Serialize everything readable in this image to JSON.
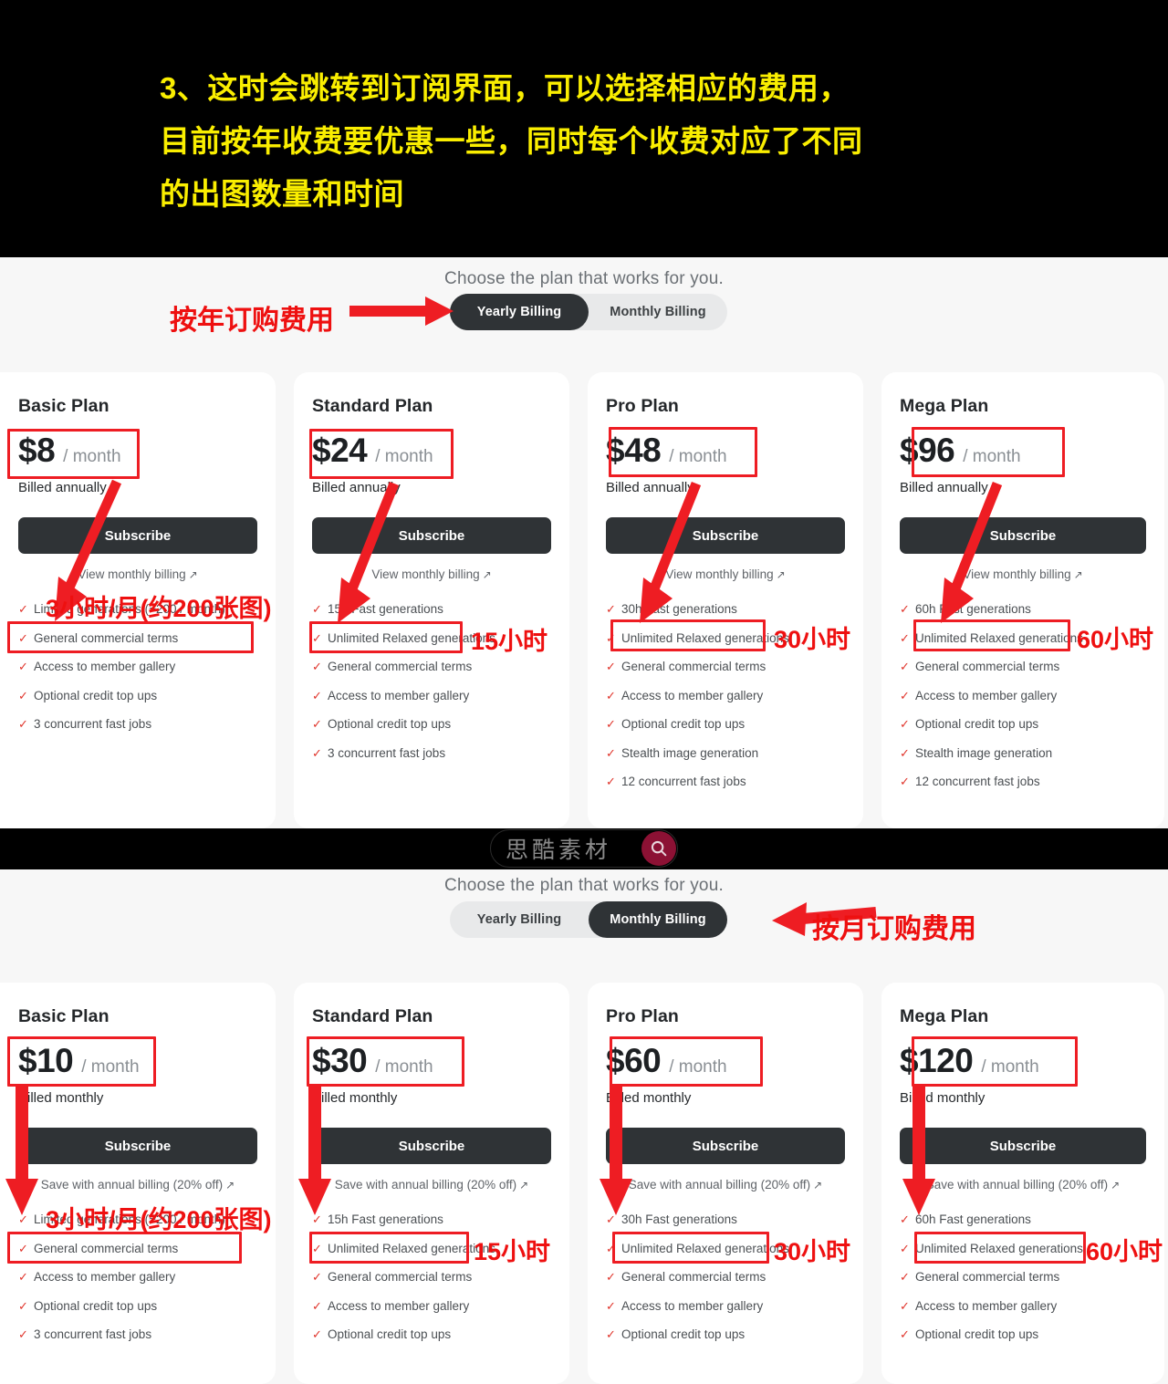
{
  "caption": {
    "text": "3、这时会跳转到订阅界面，可以选择相应的费用，\n目前按年收费要优惠一些，同时每个收费对应了不同\n的出图数量和时间",
    "color": "#FAEE00"
  },
  "watermark": {
    "text": "思酷素材",
    "icon": "search-icon",
    "circle_color": "#8c1134"
  },
  "annotations": {
    "yearly_arrow_label": "按年订购费用",
    "monthly_arrow_label": "按月订购费用",
    "basic_hours": "3小时/月(约200张图)",
    "standard_hours": "15小时",
    "pro_hours": "30小时",
    "mega_hours": "60小时",
    "highlight_color": "#ee1d23"
  },
  "sections": [
    {
      "id": "yearly",
      "heading": "Choose the plan that works for you.",
      "toggle": {
        "options": [
          {
            "label": "Yearly Billing",
            "active": true
          },
          {
            "label": "Monthly Billing",
            "active": false
          }
        ]
      },
      "cards": [
        {
          "name": "Basic Plan",
          "price": "$8",
          "unit": "/ month",
          "billed": "Billed annually",
          "subscribe_label": "Subscribe",
          "alt_link": "View monthly billing",
          "alt_link_icon": "external-link-arrow-icon",
          "features": [
            "Limited generations (~200 / month)",
            "General commercial terms",
            "Access to member gallery",
            "Optional credit top ups",
            "3 concurrent fast jobs"
          ]
        },
        {
          "name": "Standard Plan",
          "price": "$24",
          "unit": "/ month",
          "billed": "Billed annually",
          "subscribe_label": "Subscribe",
          "alt_link": "View monthly billing",
          "alt_link_icon": "external-link-arrow-icon",
          "features": [
            "15h Fast generations",
            "Unlimited Relaxed generations",
            "General commercial terms",
            "Access to member gallery",
            "Optional credit top ups",
            "3 concurrent fast jobs"
          ]
        },
        {
          "name": "Pro Plan",
          "price": "$48",
          "unit": "/ month",
          "billed": "Billed annually",
          "subscribe_label": "Subscribe",
          "alt_link": "View monthly billing",
          "alt_link_icon": "external-link-arrow-icon",
          "features": [
            "30h Fast generations",
            "Unlimited Relaxed generations",
            "General commercial terms",
            "Access to member gallery",
            "Optional credit top ups",
            "Stealth image generation",
            "12 concurrent fast jobs"
          ]
        },
        {
          "name": "Mega Plan",
          "price": "$96",
          "unit": "/ month",
          "billed": "Billed annually",
          "subscribe_label": "Subscribe",
          "alt_link": "View monthly billing",
          "alt_link_icon": "external-link-arrow-icon",
          "features": [
            "60h Fast generations",
            "Unlimited Relaxed generations",
            "General commercial terms",
            "Access to member gallery",
            "Optional credit top ups",
            "Stealth image generation",
            "12 concurrent fast jobs"
          ]
        }
      ]
    },
    {
      "id": "monthly",
      "heading": "Choose the plan that works for you.",
      "toggle": {
        "options": [
          {
            "label": "Yearly Billing",
            "active": false
          },
          {
            "label": "Monthly Billing",
            "active": true
          }
        ]
      },
      "cards": [
        {
          "name": "Basic Plan",
          "price": "$10",
          "unit": "/ month",
          "billed": "Billed monthly",
          "subscribe_label": "Subscribe",
          "alt_link": "Save with annual billing (20% off)",
          "alt_link_icon": "external-link-arrow-icon",
          "features": [
            "Limited generations (~200 / month)",
            "General commercial terms",
            "Access to member gallery",
            "Optional credit top ups",
            "3 concurrent fast jobs"
          ]
        },
        {
          "name": "Standard Plan",
          "price": "$30",
          "unit": "/ month",
          "billed": "Billed monthly",
          "subscribe_label": "Subscribe",
          "alt_link": "Save with annual billing (20% off)",
          "alt_link_icon": "external-link-arrow-icon",
          "features": [
            "15h Fast generations",
            "Unlimited Relaxed generations",
            "General commercial terms",
            "Access to member gallery",
            "Optional credit top ups"
          ]
        },
        {
          "name": "Pro Plan",
          "price": "$60",
          "unit": "/ month",
          "billed": "Billed monthly",
          "subscribe_label": "Subscribe",
          "alt_link": "Save with annual billing (20% off)",
          "alt_link_icon": "external-link-arrow-icon",
          "features": [
            "30h Fast generations",
            "Unlimited Relaxed generations",
            "General commercial terms",
            "Access to member gallery",
            "Optional credit top ups"
          ]
        },
        {
          "name": "Mega Plan",
          "price": "$120",
          "unit": "/ month",
          "billed": "Billed monthly",
          "subscribe_label": "Subscribe",
          "alt_link": "Save with annual billing (20% off)",
          "alt_link_icon": "external-link-arrow-icon",
          "features": [
            "60h Fast generations",
            "Unlimited Relaxed generations",
            "General commercial terms",
            "Access to member gallery",
            "Optional credit top ups"
          ]
        }
      ]
    }
  ]
}
